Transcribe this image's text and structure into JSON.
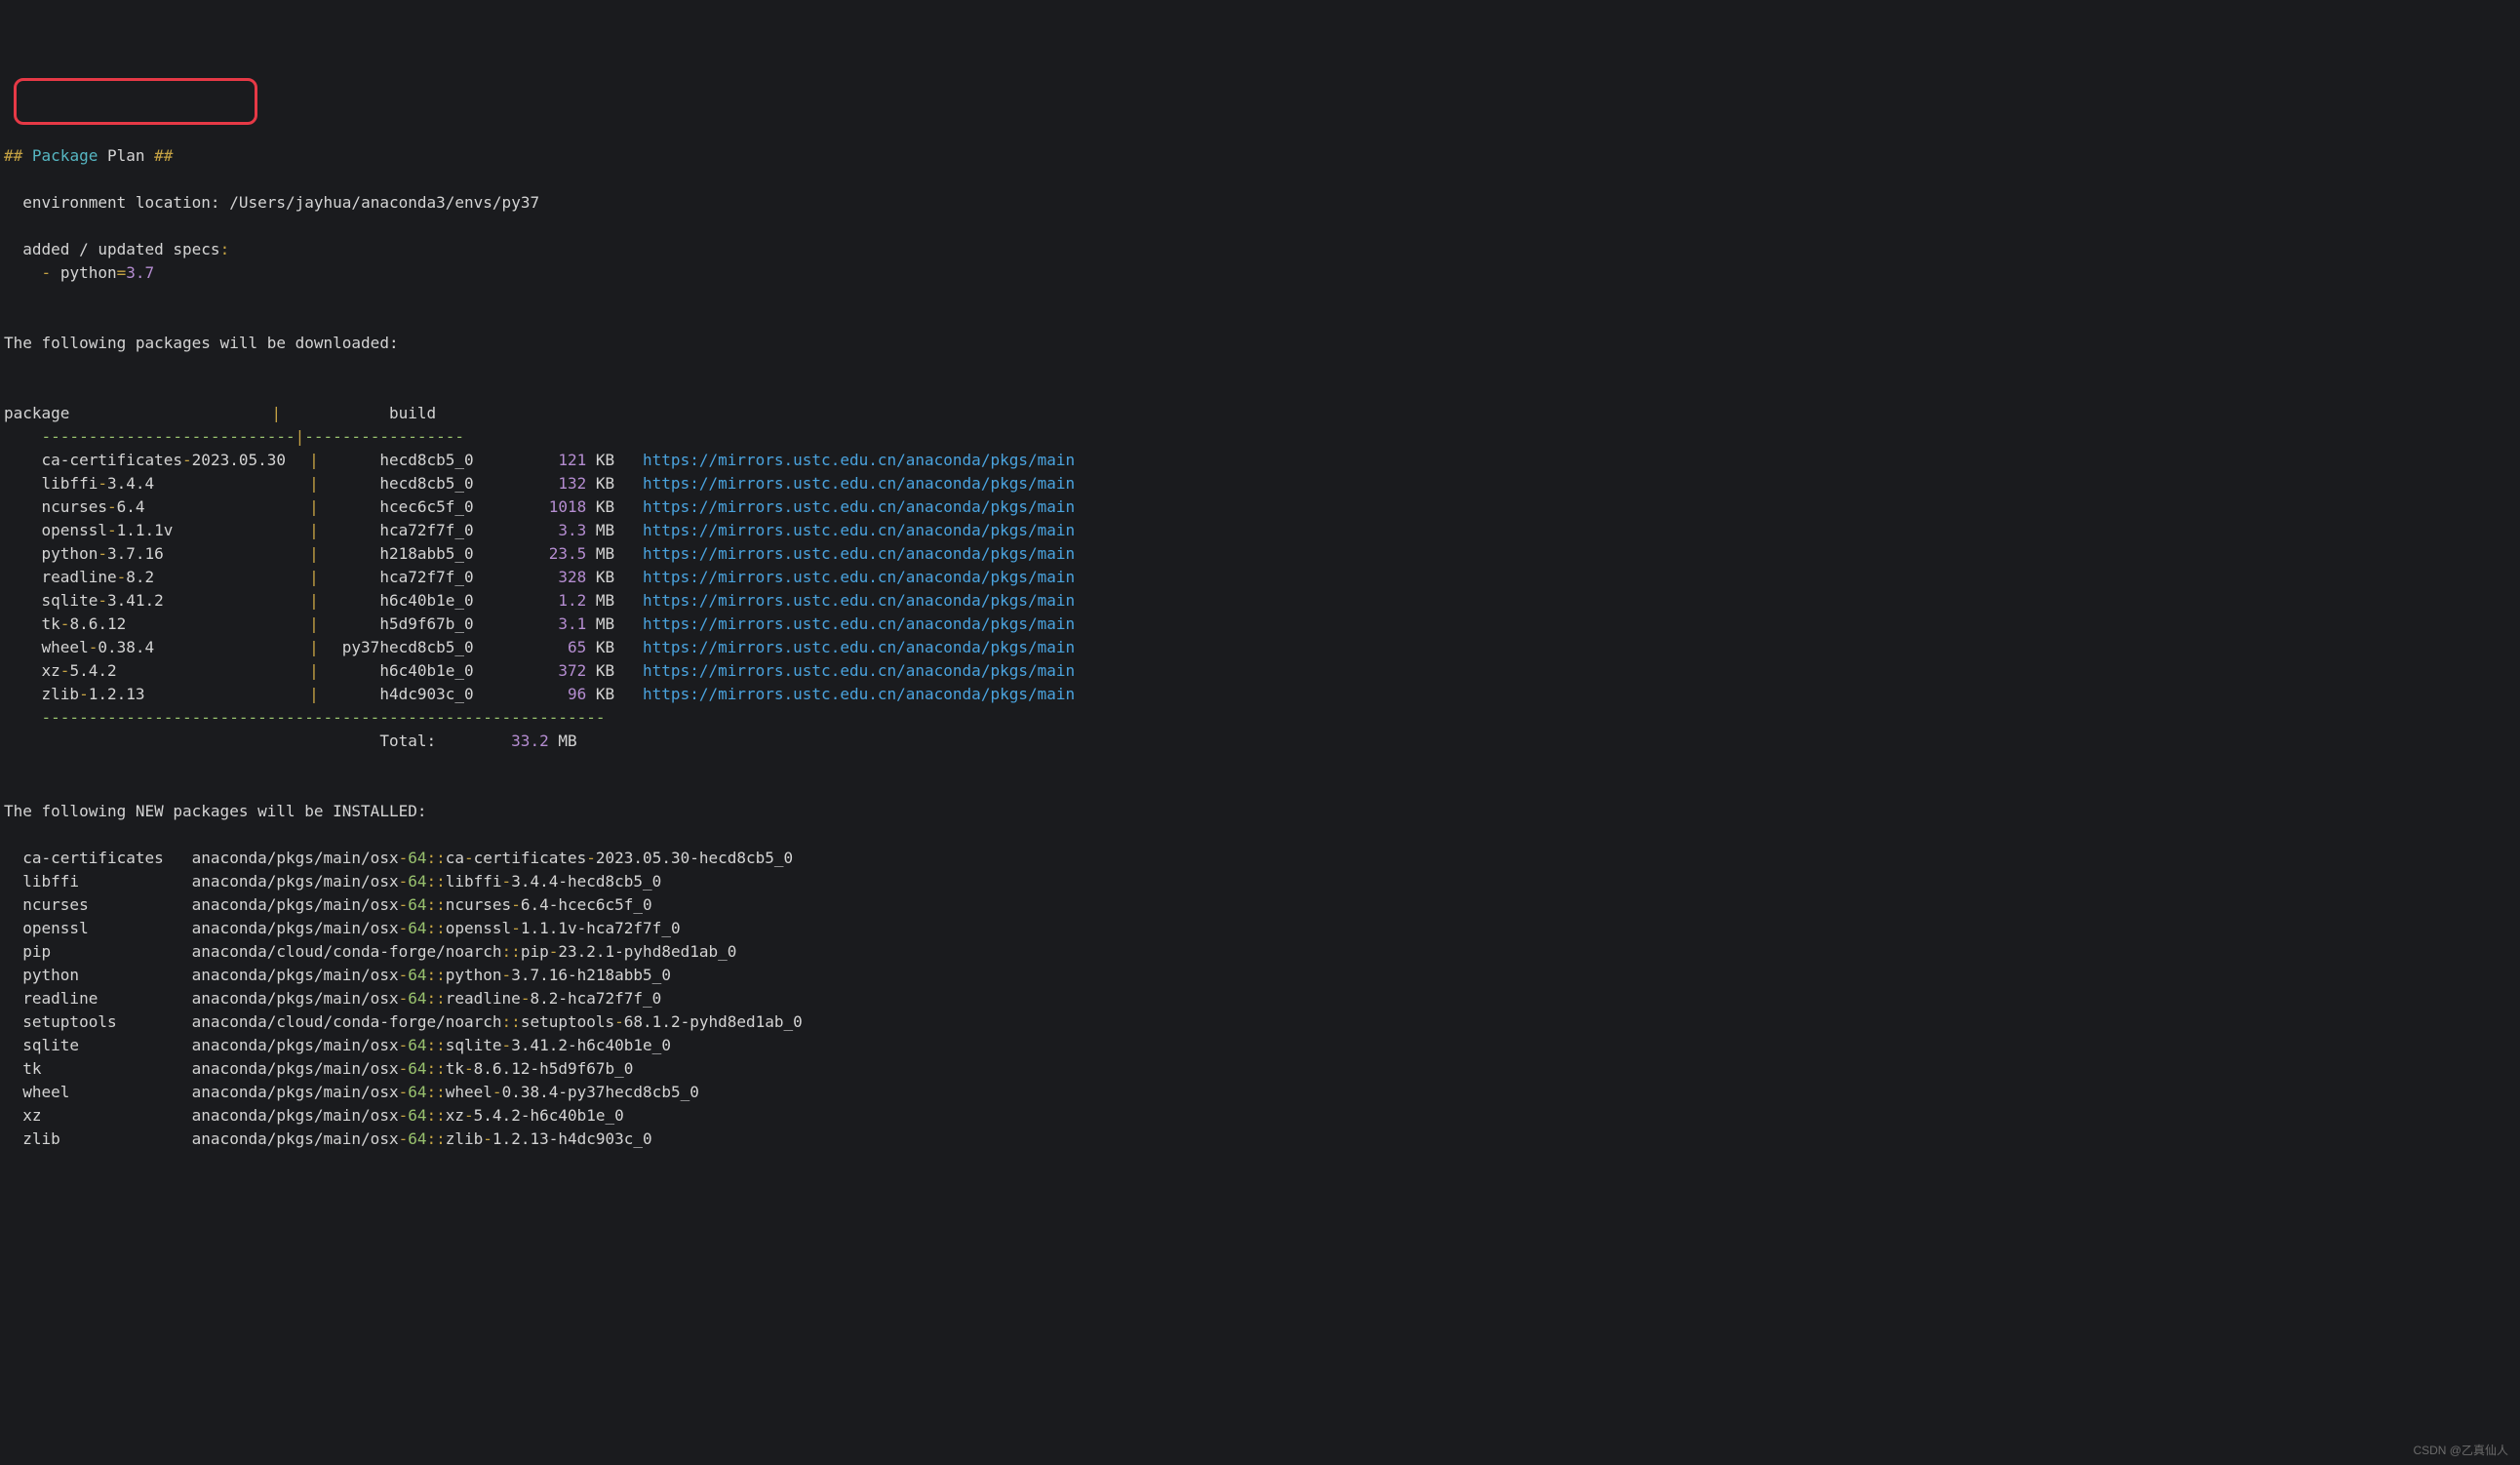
{
  "header": {
    "hashes": "##",
    "package": "Package",
    "plan": "Plan",
    "hashes2": "##"
  },
  "env_label": "environment location:",
  "env_path": "/Users/jayhua/anaconda3/envs/py37",
  "specs": {
    "added_updated": "added / updated specs",
    "colon": ":",
    "dash": "-",
    "python": "python",
    "eq": "=",
    "ver": "3.7"
  },
  "dl_heading": "The following packages will be downloaded:",
  "table": {
    "col_package": "package",
    "col_build": "build",
    "pipe": "|",
    "dashline1": "---------------------------",
    "dashline2": "-----------------",
    "longdash": "------------------------------------------------------------",
    "total_label": "Total:",
    "total_size": "33.2",
    "total_unit": "MB"
  },
  "packages": [
    {
      "name": "ca-certificates",
      "dash1": "-",
      "ver": "2023.05.30",
      "build": "hecd8cb5_0",
      "size": "121",
      "unit": "KB",
      "url": "https://mirrors.ustc.edu.cn/anaconda/pkgs/main"
    },
    {
      "name": "libffi",
      "dash1": "-",
      "ver": "3.4.4",
      "build": "hecd8cb5_0",
      "size": "132",
      "unit": "KB",
      "url": "https://mirrors.ustc.edu.cn/anaconda/pkgs/main"
    },
    {
      "name": "ncurses",
      "dash1": "-",
      "ver": "6.4",
      "build": "hcec6c5f_0",
      "size": "1018",
      "unit": "KB",
      "url": "https://mirrors.ustc.edu.cn/anaconda/pkgs/main"
    },
    {
      "name": "openssl",
      "dash1": "-",
      "ver": "1.1.1v",
      "build": "hca72f7f_0",
      "size": "3.3",
      "unit": "MB",
      "url": "https://mirrors.ustc.edu.cn/anaconda/pkgs/main"
    },
    {
      "name": "python",
      "dash1": "-",
      "ver": "3.7.16",
      "build": "h218abb5_0",
      "size": "23.5",
      "unit": "MB",
      "url": "https://mirrors.ustc.edu.cn/anaconda/pkgs/main"
    },
    {
      "name": "readline",
      "dash1": "-",
      "ver": "8.2",
      "build": "hca72f7f_0",
      "size": "328",
      "unit": "KB",
      "url": "https://mirrors.ustc.edu.cn/anaconda/pkgs/main"
    },
    {
      "name": "sqlite",
      "dash1": "-",
      "ver": "3.41.2",
      "build": "h6c40b1e_0",
      "size": "1.2",
      "unit": "MB",
      "url": "https://mirrors.ustc.edu.cn/anaconda/pkgs/main"
    },
    {
      "name": "tk",
      "dash1": "-",
      "ver": "8.6.12",
      "build": "h5d9f67b_0",
      "size": "3.1",
      "unit": "MB",
      "url": "https://mirrors.ustc.edu.cn/anaconda/pkgs/main"
    },
    {
      "name": "wheel",
      "dash1": "-",
      "ver": "0.38.4",
      "build": "py37hecd8cb5_0",
      "size": "65",
      "unit": "KB",
      "url": "https://mirrors.ustc.edu.cn/anaconda/pkgs/main"
    },
    {
      "name": "xz",
      "dash1": "-",
      "ver": "5.4.2",
      "build": "h6c40b1e_0",
      "size": "372",
      "unit": "KB",
      "url": "https://mirrors.ustc.edu.cn/anaconda/pkgs/main"
    },
    {
      "name": "zlib",
      "dash1": "-",
      "ver": "1.2.13",
      "build": "h4dc903c_0",
      "size": "96",
      "unit": "KB",
      "url": "https://mirrors.ustc.edu.cn/anaconda/pkgs/main"
    }
  ],
  "install_heading": "The following NEW packages will be INSTALLED:",
  "installs": [
    {
      "name": "ca-certificates",
      "pre": "anaconda/pkgs/main/osx",
      "d": "-",
      "p64": "64",
      "cc": "::",
      "pkg": "ca",
      "d2": "-",
      "rest": "certificates",
      "d3": "-",
      "tail": "2023.05.30-hecd8cb5_0"
    },
    {
      "name": "libffi",
      "pre": "anaconda/pkgs/main/osx",
      "d": "-",
      "p64": "64",
      "cc": "::",
      "pkg": "libffi",
      "d2": "-",
      "rest": "3.4.4-hecd8cb5_0",
      "d3": "",
      "tail": ""
    },
    {
      "name": "ncurses",
      "pre": "anaconda/pkgs/main/osx",
      "d": "-",
      "p64": "64",
      "cc": "::",
      "pkg": "ncurses",
      "d2": "-",
      "rest": "6.4-hcec6c5f_0",
      "d3": "",
      "tail": ""
    },
    {
      "name": "openssl",
      "pre": "anaconda/pkgs/main/osx",
      "d": "-",
      "p64": "64",
      "cc": "::",
      "pkg": "openssl",
      "d2": "-",
      "rest": "1.1.1v-hca72f7f_0",
      "d3": "",
      "tail": ""
    },
    {
      "name": "pip",
      "pre": "anaconda/cloud/conda-forge/noarch",
      "d": "",
      "p64": "",
      "cc": "::",
      "pkg": "pip",
      "d2": "-",
      "rest": "23.2.1-pyhd8ed1ab_0",
      "d3": "",
      "tail": ""
    },
    {
      "name": "python",
      "pre": "anaconda/pkgs/main/osx",
      "d": "-",
      "p64": "64",
      "cc": "::",
      "pkg": "python",
      "d2": "-",
      "rest": "3.7.16-h218abb5_0",
      "d3": "",
      "tail": ""
    },
    {
      "name": "readline",
      "pre": "anaconda/pkgs/main/osx",
      "d": "-",
      "p64": "64",
      "cc": "::",
      "pkg": "readline",
      "d2": "-",
      "rest": "8.2-hca72f7f_0",
      "d3": "",
      "tail": ""
    },
    {
      "name": "setuptools",
      "pre": "anaconda/cloud/conda-forge/noarch",
      "d": "",
      "p64": "",
      "cc": "::",
      "pkg": "setuptools",
      "d2": "-",
      "rest": "68.1.2-pyhd8ed1ab_0",
      "d3": "",
      "tail": ""
    },
    {
      "name": "sqlite",
      "pre": "anaconda/pkgs/main/osx",
      "d": "-",
      "p64": "64",
      "cc": "::",
      "pkg": "sqlite",
      "d2": "-",
      "rest": "3.41.2-h6c40b1e_0",
      "d3": "",
      "tail": ""
    },
    {
      "name": "tk",
      "pre": "anaconda/pkgs/main/osx",
      "d": "-",
      "p64": "64",
      "cc": "::",
      "pkg": "tk",
      "d2": "-",
      "rest": "8.6.12-h5d9f67b_0",
      "d3": "",
      "tail": ""
    },
    {
      "name": "wheel",
      "pre": "anaconda/pkgs/main/osx",
      "d": "-",
      "p64": "64",
      "cc": "::",
      "pkg": "wheel",
      "d2": "-",
      "rest": "0.38.4-py37hecd8cb5_0",
      "d3": "",
      "tail": ""
    },
    {
      "name": "xz",
      "pre": "anaconda/pkgs/main/osx",
      "d": "-",
      "p64": "64",
      "cc": "::",
      "pkg": "xz",
      "d2": "-",
      "rest": "5.4.2-h6c40b1e_0",
      "d3": "",
      "tail": ""
    },
    {
      "name": "zlib",
      "pre": "anaconda/pkgs/main/osx",
      "d": "-",
      "p64": "64",
      "cc": "::",
      "pkg": "zlib",
      "d2": "-",
      "rest": "1.2.13-h4dc903c_0",
      "d3": "",
      "tail": ""
    }
  ],
  "watermark": "CSDN @乙真仙人"
}
